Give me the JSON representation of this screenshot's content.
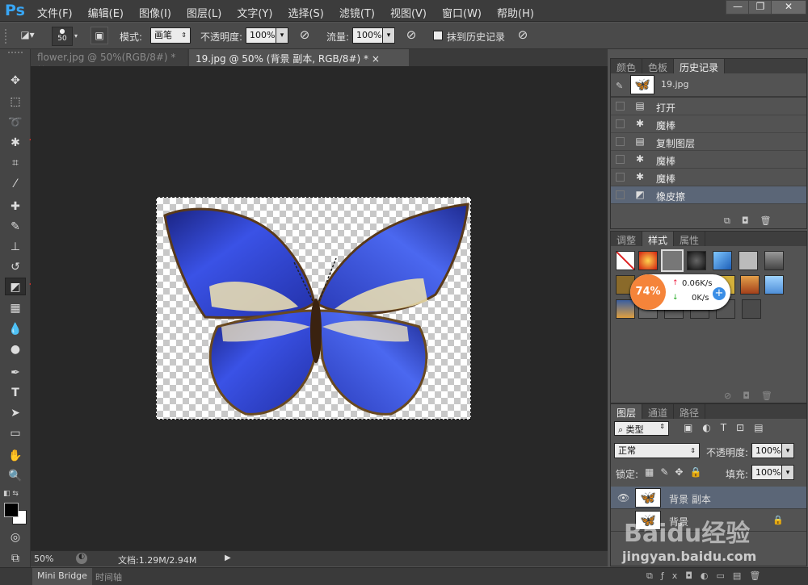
{
  "app": {
    "logo": "Ps"
  },
  "menu": [
    "文件(F)",
    "编辑(E)",
    "图像(I)",
    "图层(L)",
    "文字(Y)",
    "选择(S)",
    "滤镜(T)",
    "视图(V)",
    "窗口(W)",
    "帮助(H)"
  ],
  "window_controls": {
    "minimize": "—",
    "restore": "❐",
    "close": "✕"
  },
  "options": {
    "brush_size": "50",
    "mode_label": "模式:",
    "mode_value": "画笔",
    "opacity_label": "不透明度:",
    "opacity_value": "100%",
    "flow_label": "流量:",
    "flow_value": "100%",
    "history_label": "抹到历史记录"
  },
  "tabs": [
    {
      "label": "flower.jpg @ 50%(RGB/8#) *",
      "close": "×"
    },
    {
      "label": "19.jpg @ 50% (背景 副本, RGB/8#) *",
      "close": "×"
    }
  ],
  "status": {
    "zoom": "50%",
    "doc_info": "文档:1.29M/2.94M"
  },
  "bottom_tabs": [
    "Mini Bridge",
    "时间轴"
  ],
  "history_panel": {
    "tabs": [
      "颜色",
      "色板",
      "历史记录"
    ],
    "snapshot": "19.jpg",
    "items": [
      {
        "label": "打开",
        "icon": "doc-icon"
      },
      {
        "label": "魔棒",
        "icon": "wand-icon"
      },
      {
        "label": "复制图层",
        "icon": "doc-icon"
      },
      {
        "label": "魔棒",
        "icon": "wand-icon"
      },
      {
        "label": "魔棒",
        "icon": "wand-icon"
      },
      {
        "label": "橡皮擦",
        "icon": "eraser-icon"
      }
    ]
  },
  "styles_panel": {
    "tabs": [
      "调整",
      "样式",
      "属性"
    ]
  },
  "net_widget": {
    "percent": "74%",
    "up": "0.06K/s",
    "down": "0K/s"
  },
  "layers_panel": {
    "tabs": [
      "图层",
      "通道",
      "路径"
    ],
    "filter": "类型",
    "blend_mode": "正常",
    "opacity_label": "不透明度:",
    "opacity_value": "100%",
    "lock_label": "锁定:",
    "fill_label": "填充:",
    "fill_value": "100%",
    "layers": [
      {
        "name": "背景 副本"
      },
      {
        "name": "背景"
      }
    ]
  },
  "watermark": {
    "brand": "Baidu经验",
    "url": "jingyan.baidu.com"
  },
  "colors": {
    "accent": "#38a6f5",
    "selection": "#5b6677",
    "arrow": "#e0312b",
    "butterfly": "#2b3fd8"
  }
}
